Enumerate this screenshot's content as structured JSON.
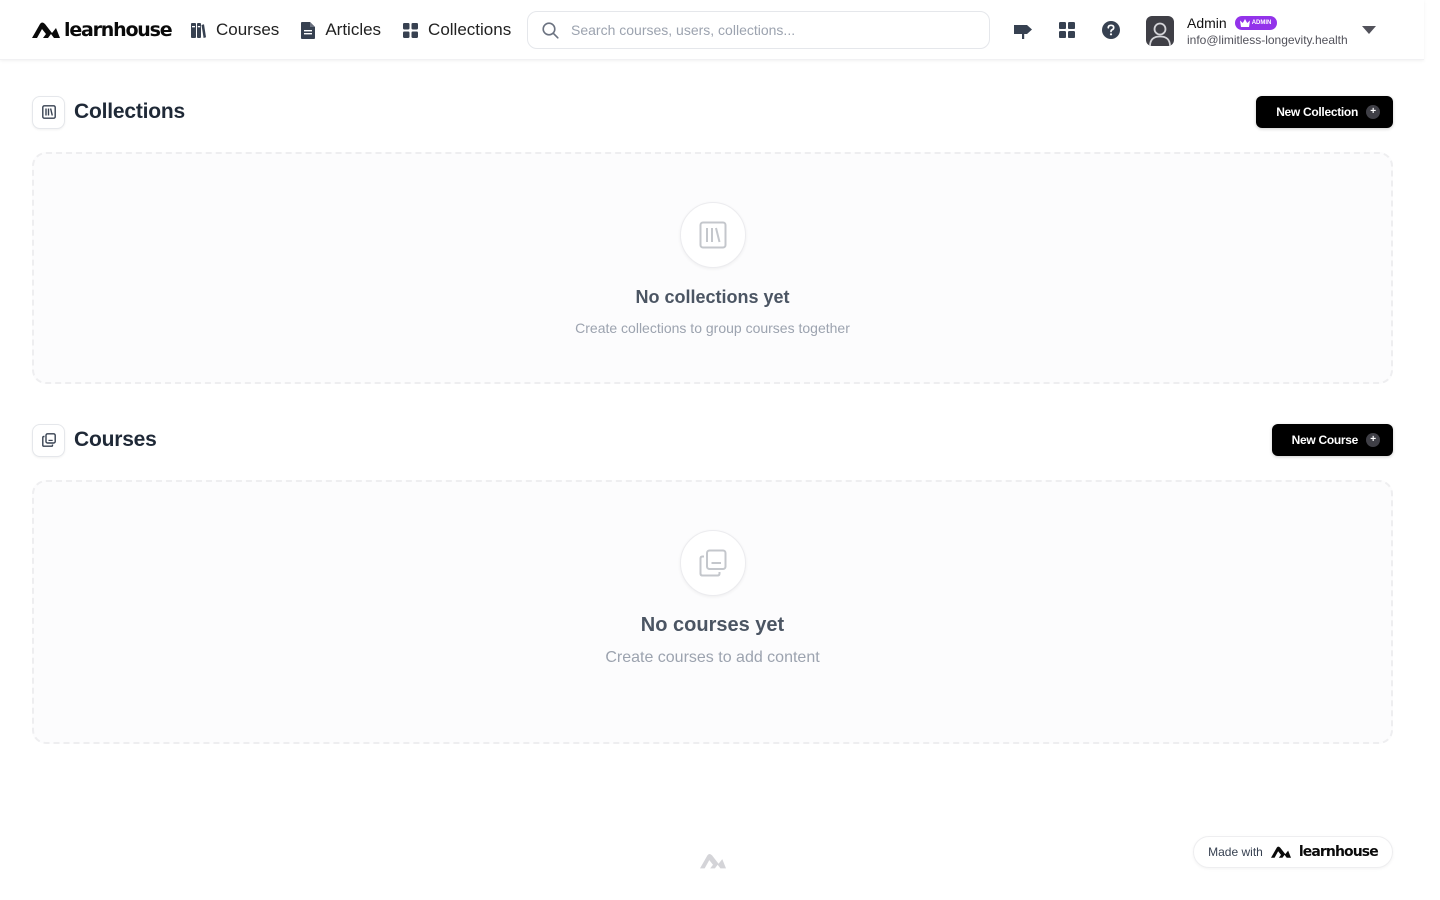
{
  "header": {
    "brand": "learnhouse",
    "nav": [
      {
        "label": "Courses",
        "icon": "books-icon"
      },
      {
        "label": "Articles",
        "icon": "document-icon"
      },
      {
        "label": "Collections",
        "icon": "grid-icon"
      }
    ],
    "search": {
      "placeholder": "Search courses, users, collections..."
    },
    "icons": [
      "signpost-icon",
      "apps-grid-icon",
      "help-icon"
    ],
    "user": {
      "name": "Admin",
      "role_badge": "ADMIN",
      "email": "info@limitless-longevity.health"
    }
  },
  "collections": {
    "title": "Collections",
    "button_label": "New Collection",
    "empty_title": "No collections yet",
    "empty_subtitle": "Create collections to group courses together"
  },
  "courses": {
    "title": "Courses",
    "button_label": "New Course",
    "empty_title": "No courses yet",
    "empty_subtitle": "Create courses to add content"
  },
  "footer": {
    "made_with": "Made with",
    "brand": "learnhouse"
  },
  "colors": {
    "accent": "#000000",
    "admin_badge": "#9333ea",
    "muted_text": "#9ca3af"
  }
}
